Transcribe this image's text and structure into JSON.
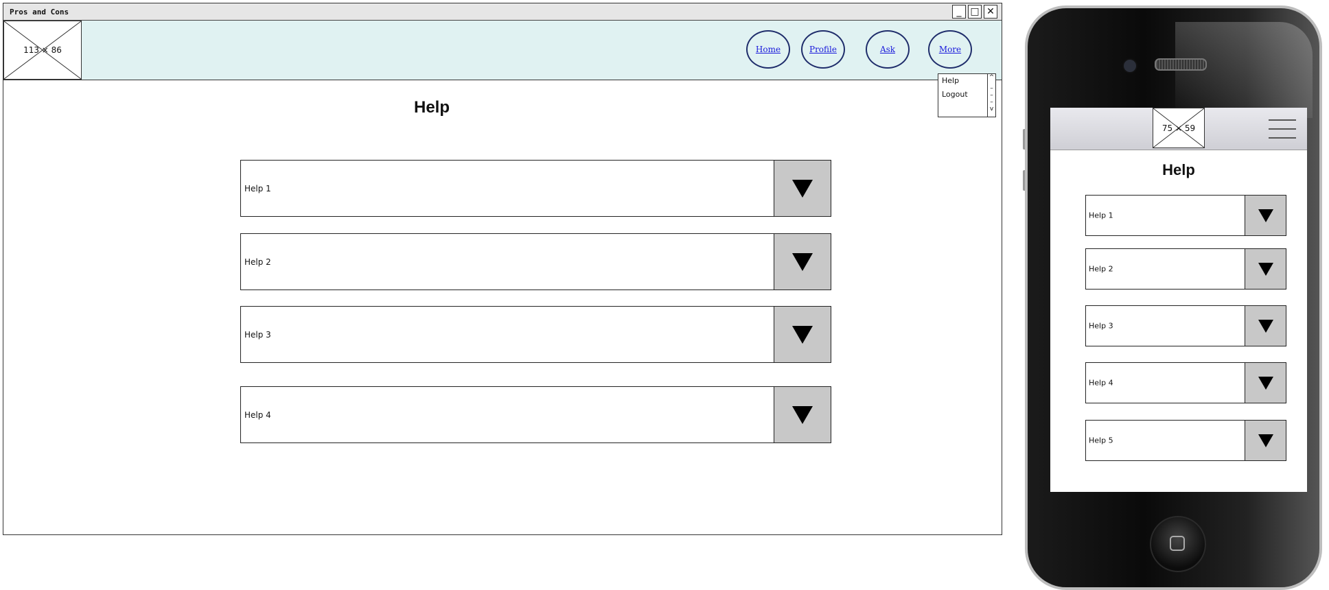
{
  "window": {
    "title": "Pros and Cons",
    "controls": {
      "minimize": "_",
      "maximize": "□",
      "close": "✕"
    }
  },
  "header": {
    "logo_placeholder": "113 × 86",
    "nav": [
      {
        "label": "Home"
      },
      {
        "label": "Profile"
      },
      {
        "label": "Ask"
      },
      {
        "label": "More"
      }
    ],
    "more_menu": [
      "Help",
      "Logout"
    ]
  },
  "desktop_page": {
    "title": "Help",
    "accordion": [
      {
        "label": "Help 1"
      },
      {
        "label": "Help 2"
      },
      {
        "label": "Help 3"
      },
      {
        "label": "Help 4"
      }
    ]
  },
  "mobile_page": {
    "logo_placeholder": "75 × 59",
    "title": "Help",
    "accordion": [
      {
        "label": "Help 1"
      },
      {
        "label": "Help 2"
      },
      {
        "label": "Help 3"
      },
      {
        "label": "Help 4"
      },
      {
        "label": "Help 5"
      }
    ]
  },
  "colors": {
    "header_bg": "#e0f2f2",
    "nav_border": "#1f2d6b",
    "link": "#1a1adb",
    "arrow_bg": "#c8c8c8"
  }
}
